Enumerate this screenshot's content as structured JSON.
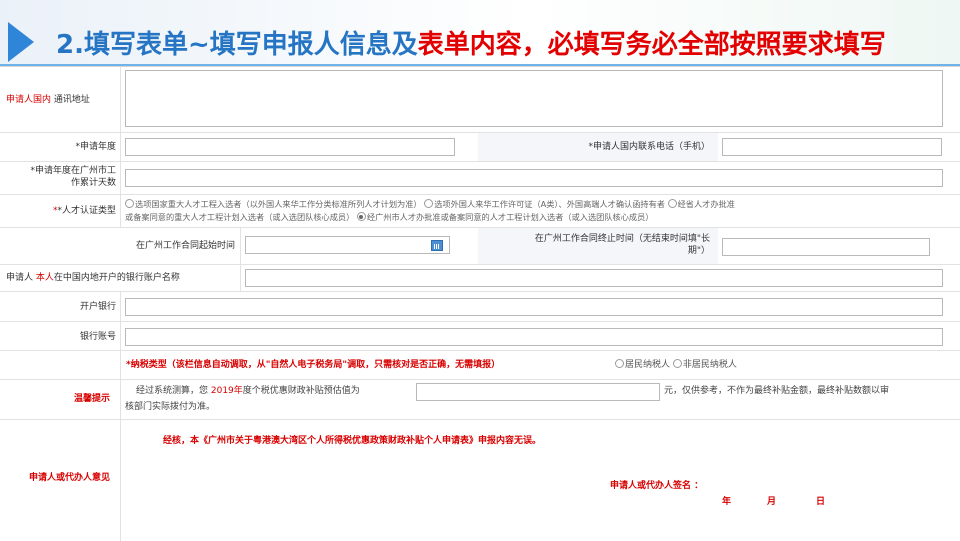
{
  "header": {
    "title_part1": "2.填写表单~填写申报人信息及",
    "title_part2": "表单内容，必填写务必全部按照要求填写"
  },
  "form": {
    "domestic_address_label_red": "申请人国内",
    "domestic_address_label": " 通讯地址",
    "apply_year_label": "*申请年度",
    "phone_label": "*申请人国内联系电话（手机）",
    "work_days_label_line1": "*申请年度在广州市工",
    "work_days_label_line2": "作累计天数",
    "talent_type_label": "*人才认证类型",
    "talent_opt1": "选项国家重大人才工程入选者（以外国人来华工作分类标准所列人才计划为准）",
    "talent_opt2": "选项外国人来华工作许可证（A类）、外国高端人才确认函持有者",
    "talent_opt3": "经省人才办批准",
    "talent_opt3b": "或备案同意的重大人才工程计划入选者（或入选团队核心成员）",
    "talent_opt4": "经广州市人才办批准或备案同意的人才工程计划入选者（或入选团队核心成员）",
    "contract_start_label": "在广州工作合同起始时间",
    "contract_end_label_line1": "在广州工作合同终止时间（无结束时间填\"长",
    "contract_end_label_line2": "期\"）",
    "bank_account_label_a": "申请人 ",
    "bank_account_label_red": "本人",
    "bank_account_label_b": "在中国内地开户的银行账户名称",
    "bank_label": "开户银行",
    "account_no_label": "银行账号",
    "tax_type_label": "*纳税类型",
    "tax_type_note": "（该栏信息自动调取，从\"自然人电子税务局\"调取，只需核对是否正确，无需填报）",
    "tax_opt_resident": "居民纳税人",
    "tax_opt_nonresident": "非居民纳税人",
    "tip_label": "温馨提示",
    "tip_text_a": "经过系统测算，您 ",
    "tip_year": "2019年",
    "tip_text_b": "度个税优惠财政补贴预估值为",
    "tip_text_c": "元，仅供参考，不作为最终补贴金额，最终补贴数额以审",
    "tip_text_d": "核部门实际拨付为准。",
    "opinion_label": "申请人或代办人意见",
    "opinion_text": "经核，本《广州市关于粤港澳大湾区个人所得税优惠政策财政补贴个人申请表》申报内容无误。",
    "signature_label": "申请人或代办人签名 ：",
    "date_year": "年",
    "date_month": "月",
    "date_day": "日"
  },
  "colors": {
    "accent_blue": "#2575c4",
    "accent_red": "#e30000"
  }
}
